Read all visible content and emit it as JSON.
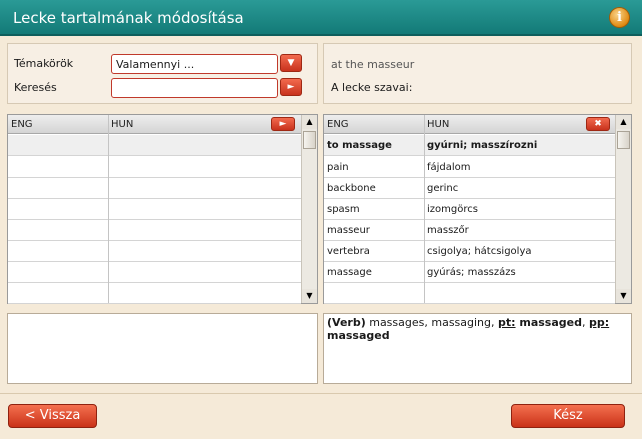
{
  "window": {
    "title": "Lecke tartalmának módosítása"
  },
  "filters": {
    "topic_label": "Témakörök",
    "topic_value": "Valamennyi ...",
    "search_label": "Keresés",
    "search_value": ""
  },
  "lesson": {
    "name": "at the masseur",
    "words_label": "A lecke szavai:"
  },
  "left_grid": {
    "headers": [
      "ENG",
      "HUN"
    ],
    "rows": []
  },
  "right_grid": {
    "headers": [
      "ENG",
      "HUN"
    ],
    "rows": [
      [
        "to massage",
        "gyúrni; masszírozni"
      ],
      [
        "pain",
        "fájdalom"
      ],
      [
        "backbone",
        "gerinc"
      ],
      [
        "spasm",
        "izomgörcs"
      ],
      [
        "masseur",
        "masszőr"
      ],
      [
        "vertebra",
        "csigolya; hátcsigolya"
      ],
      [
        "massage",
        "gyúrás; masszázs"
      ]
    ]
  },
  "details": {
    "pos": "(Verb)",
    "forms": " massages, massaging, ",
    "pt_label": "pt:",
    "pt_value": " massaged",
    "sep": ", ",
    "pp_label": "pp:",
    "pp_value": " massaged"
  },
  "buttons": {
    "back": "< Vissza",
    "done": "Kész"
  },
  "icons": {
    "info": "info-icon",
    "dropdown": "chevron-down-icon",
    "go": "arrow-right-icon",
    "add": "arrow-right-icon",
    "remove": "close-icon"
  }
}
